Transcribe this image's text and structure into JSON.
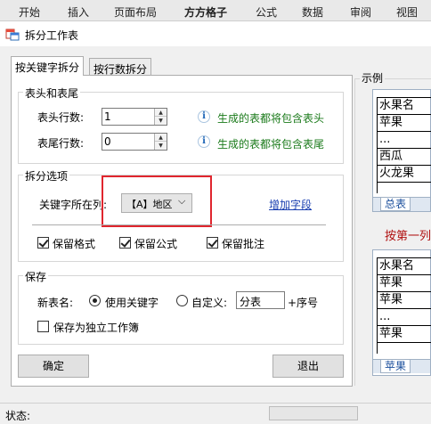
{
  "ribbon": {
    "tabs": [
      "开始",
      "插入",
      "页面布局",
      "方方格子",
      "公式",
      "数据",
      "审阅",
      "视图"
    ]
  },
  "dialog": {
    "title": "拆分工作表"
  },
  "tabs": {
    "keyword": "按关键字拆分",
    "rows": "按行数拆分"
  },
  "header_footer": {
    "title": "表头和表尾",
    "header_label": "表头行数:",
    "header_value": "1",
    "header_info": "生成的表都将包含表头",
    "footer_label": "表尾行数:",
    "footer_value": "0",
    "footer_info": "生成的表都将包含表尾"
  },
  "split_options": {
    "title": "拆分选项",
    "column_label": "关键字所在列:",
    "column_value": "【A】地区",
    "add_field": "增加字段",
    "keep_format": "保留格式",
    "keep_formula": "保留公式",
    "keep_comment": "保留批注"
  },
  "save": {
    "title": "保存",
    "new_name_label": "新表名:",
    "use_keyword": "使用关键字",
    "custom": "自定义:",
    "custom_value": "分表",
    "suffix": "+序号",
    "standalone": "保存为独立工作簿"
  },
  "buttons": {
    "ok": "确定",
    "exit": "退出"
  },
  "status": {
    "label": "状态:"
  },
  "example": {
    "title": "示例",
    "sheet1": [
      "水果名",
      "苹果",
      "...",
      "西瓜",
      "火龙果"
    ],
    "sheet1_tab": "总表",
    "split_note": "按第一列",
    "sheet2": [
      "水果名",
      "苹果",
      "苹果",
      "...",
      "苹果"
    ],
    "sheet2_tab": "苹果"
  }
}
